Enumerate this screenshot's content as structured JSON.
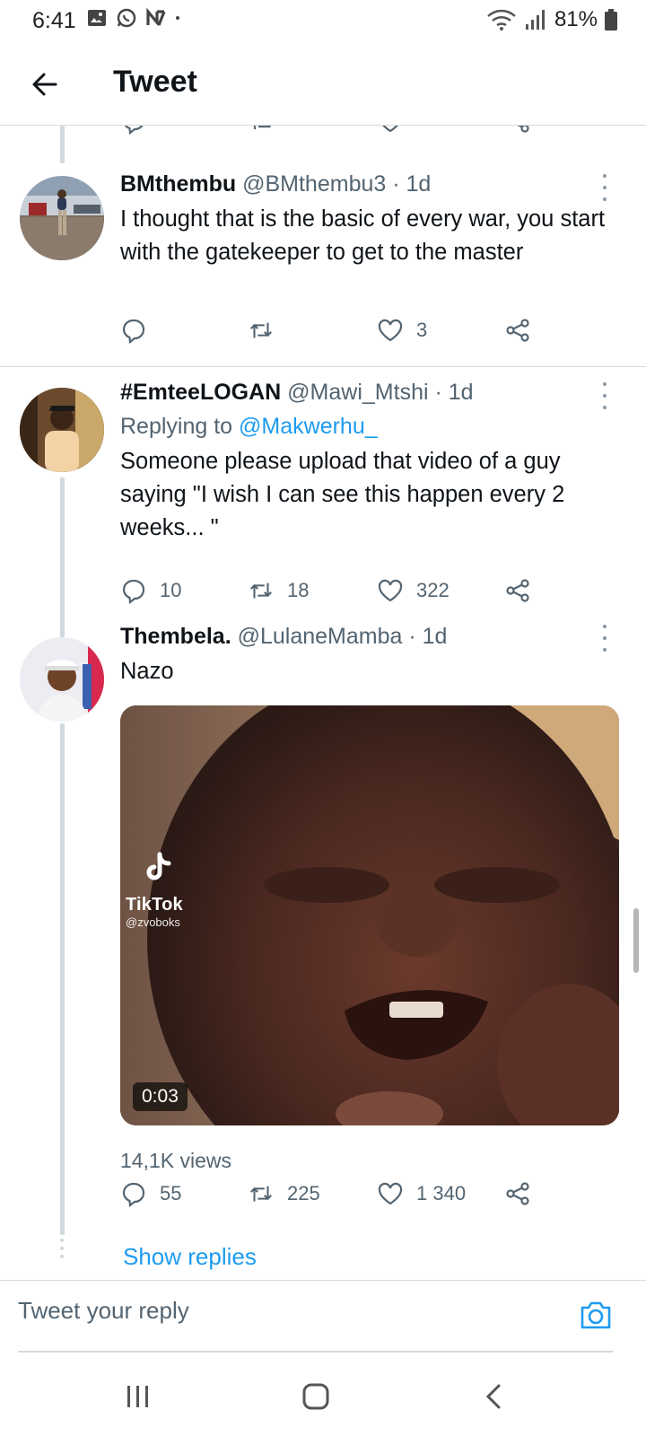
{
  "status_bar": {
    "time": "6:41",
    "battery": "81%"
  },
  "header": {
    "title": "Tweet"
  },
  "tweets": [
    {
      "name": "BMthembu",
      "handle": "@BMthembu3",
      "time": " · 1d",
      "text": "I thought that is the basic of every war, you start with the gatekeeper to get to the master",
      "replies": "",
      "retweets": "",
      "likes": "3"
    },
    {
      "name": "#EmteeLOGAN",
      "handle": "@Mawi_Mtshi",
      "time": " · 1d",
      "replying_prefix": "Replying to ",
      "replying_to": "@Makwerhu_",
      "text": "Someone please upload that video of a guy saying \"I wish I can see this happen every 2 weeks... \"",
      "replies": "10",
      "retweets": "18",
      "likes": "322"
    },
    {
      "name": "Thembela.",
      "handle": "@LulaneMamba",
      "time": " · 1d",
      "text": "Nazo",
      "media": {
        "watermark_name": "TikTok",
        "watermark_handle": "@zvoboks",
        "duration": "0:03"
      },
      "views": "14,1K views",
      "replies": "55",
      "retweets": "225",
      "likes": "1 340"
    }
  ],
  "show_replies": "Show replies",
  "reply_bar": {
    "placeholder": "Tweet your reply"
  },
  "colors": {
    "accent": "#1d9bf0",
    "secondary_text": "#536471",
    "thread_line": "#cfd9de"
  },
  "icons": [
    "back-arrow-icon",
    "reply-icon",
    "retweet-icon",
    "like-icon",
    "share-icon",
    "more-icon",
    "camera-icon",
    "recents-icon",
    "home-icon",
    "back-icon"
  ]
}
